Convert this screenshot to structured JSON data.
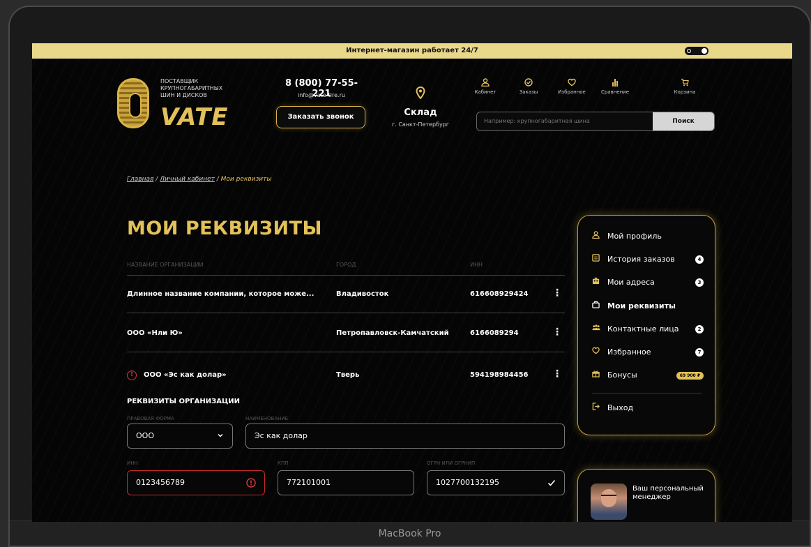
{
  "device_label": "MacBook Pro",
  "topbar": {
    "text": "Интернет-магазин работает 24/7"
  },
  "logo": {
    "tagline": "ПОСТАВЩИК КРУПНОГАБАРИТНЫХ ШИН И ДИСКОВ",
    "brand": "VATE"
  },
  "contacts": {
    "phone": "8 (800) 77-55-221",
    "email": "info@vate-tire.ru",
    "call_button": "Заказать звонок"
  },
  "stock": {
    "title": "Склад",
    "city": "г. Санкт-Петербург"
  },
  "nav": [
    {
      "label": "Кабинет",
      "icon": "user-icon"
    },
    {
      "label": "Заказы",
      "icon": "orders-icon"
    },
    {
      "label": "Избранное",
      "icon": "heart-icon"
    },
    {
      "label": "Сравнение",
      "icon": "compare-icon"
    },
    {
      "label": "Корзина",
      "icon": "cart-icon"
    }
  ],
  "search": {
    "placeholder": "Например: крупногабаритная шина",
    "button": "Поиск"
  },
  "breadcrumbs": {
    "home": "Главная",
    "separator": "/",
    "cabinet": "Личный кабинет",
    "current": "Мои реквизиты"
  },
  "page_title": "МОИ РЕКВИЗИТЫ",
  "table": {
    "headers": {
      "name": "НАЗВАНИЕ ОРГАНИЗАЦИИ",
      "city": "ГОРОД",
      "inn": "ИНН"
    },
    "rows": [
      {
        "name": "Длинное название компании, которое може...",
        "city": "Владивосток",
        "inn": "616608929424"
      },
      {
        "name": "ООО «Нли Ю»",
        "city": "Петропавловск-Камчатский",
        "inn": "6166089294"
      },
      {
        "name": "ООО «Эс как долар»",
        "city": "Тверь",
        "inn": "594198984456",
        "error": true
      }
    ]
  },
  "form": {
    "section_title": "РЕКВИЗИТЫ ОРГАНИЗАЦИИ",
    "legal_form": {
      "label": "ПРАВОВАЯ ФОРМА",
      "value": "ООО"
    },
    "name": {
      "label": "НАИМЕНОВАНИЕ",
      "value": "Эс как долар"
    },
    "inn": {
      "label": "ИНН",
      "value": "0123456789"
    },
    "kpp": {
      "label": "КПП",
      "value": "772101001"
    },
    "ogrn": {
      "label": "ОГРН ИЛИ ОГРНИП",
      "value": "1027700132195"
    }
  },
  "sidebar": {
    "items": [
      {
        "label": "Мой профиль",
        "icon": "user-icon"
      },
      {
        "label": "История заказов",
        "icon": "history-icon",
        "badge": "4"
      },
      {
        "label": "Мои адреса",
        "icon": "building-icon",
        "badge": "3"
      },
      {
        "label": "Мои реквизиты",
        "icon": "briefcase-icon",
        "active": true
      },
      {
        "label": "Контактные лица",
        "icon": "users-icon",
        "badge": "2"
      },
      {
        "label": "Избранное",
        "icon": "heart-icon",
        "badge": "7"
      },
      {
        "label": "Бонусы",
        "icon": "gift-icon",
        "badge": "69 900 ₽"
      }
    ],
    "logout": "Выход"
  },
  "manager": {
    "text": "Ваш персональный менеджер"
  },
  "colors": {
    "accent": "#e3c15a",
    "error": "#d23a3a",
    "topbar": "#ead88a"
  }
}
